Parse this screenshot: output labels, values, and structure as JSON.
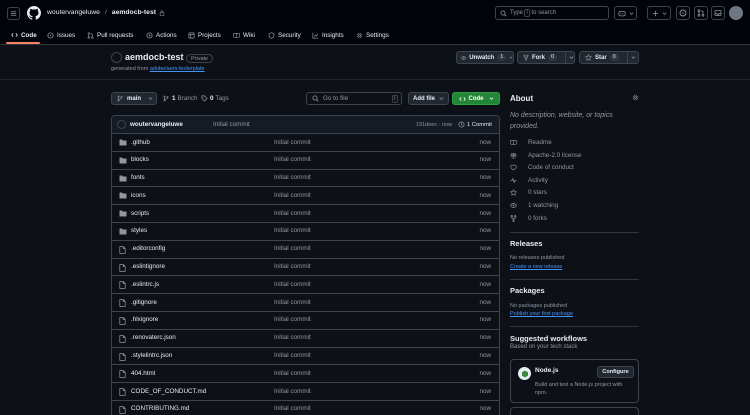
{
  "header": {
    "owner": "woutervangeluwe",
    "slash": "/",
    "repo": "aemdocb-test",
    "search_prefix": "Type",
    "search_key": "/",
    "search_suffix": "to search"
  },
  "tabs": [
    {
      "label": "Code"
    },
    {
      "label": "Issues"
    },
    {
      "label": "Pull requests"
    },
    {
      "label": "Actions"
    },
    {
      "label": "Projects"
    },
    {
      "label": "Wiki"
    },
    {
      "label": "Security"
    },
    {
      "label": "Insights"
    },
    {
      "label": "Settings"
    }
  ],
  "repo": {
    "title": "aemdocb-test",
    "visibility": "Private",
    "generated_from": "generated from",
    "template": "adobe/aem-boilerplate",
    "unwatch_label": "Unwatch",
    "unwatch_count": "1",
    "fork_label": "Fork",
    "fork_count": "0",
    "star_label": "Star",
    "star_count": "0"
  },
  "toolbar": {
    "branch": "main",
    "branch_count": "1",
    "branch_label": "Branch",
    "tag_count": "0",
    "tag_label": "Tags",
    "goto_placeholder": "Go to file",
    "goto_key": "t",
    "add_file": "Add file",
    "code": "Code"
  },
  "latest_commit": {
    "author": "woutervangeluwe",
    "message": "Initial commit",
    "hash_time": "191deec · now",
    "count_label": "1 Commit"
  },
  "files": [
    {
      "name": ".github",
      "type": "dir",
      "message": "Initial commit",
      "time": "now"
    },
    {
      "name": "blocks",
      "type": "dir",
      "message": "Initial commit",
      "time": "now"
    },
    {
      "name": "fonts",
      "type": "dir",
      "message": "Initial commit",
      "time": "now"
    },
    {
      "name": "icons",
      "type": "dir",
      "message": "Initial commit",
      "time": "now"
    },
    {
      "name": "scripts",
      "type": "dir",
      "message": "Initial commit",
      "time": "now"
    },
    {
      "name": "styles",
      "type": "dir",
      "message": "Initial commit",
      "time": "now"
    },
    {
      "name": ".editorconfig",
      "type": "file",
      "message": "Initial commit",
      "time": "now"
    },
    {
      "name": ".eslintignore",
      "type": "file",
      "message": "Initial commit",
      "time": "now"
    },
    {
      "name": ".eslintrc.js",
      "type": "file",
      "message": "Initial commit",
      "time": "now"
    },
    {
      "name": ".gitignore",
      "type": "file",
      "message": "Initial commit",
      "time": "now"
    },
    {
      "name": ".hlxignore",
      "type": "file",
      "message": "Initial commit",
      "time": "now"
    },
    {
      "name": ".renovaterc.json",
      "type": "file",
      "message": "Initial commit",
      "time": "now"
    },
    {
      "name": ".stylelintrc.json",
      "type": "file",
      "message": "Initial commit",
      "time": "now"
    },
    {
      "name": "404.html",
      "type": "file",
      "message": "Initial commit",
      "time": "now"
    },
    {
      "name": "CODE_OF_CONDUCT.md",
      "type": "file",
      "message": "Initial commit",
      "time": "now"
    },
    {
      "name": "CONTRIBUTING.md",
      "type": "file",
      "message": "Initial commit",
      "time": "now"
    }
  ],
  "about": {
    "heading": "About",
    "description": "No description, website, or topics provided.",
    "items": [
      {
        "label": "Readme",
        "icon": "book-icon"
      },
      {
        "label": "Apache-2.0 license",
        "icon": "law-icon"
      },
      {
        "label": "Code of conduct",
        "icon": "heart-icon"
      },
      {
        "label": "Activity",
        "icon": "pulse-icon"
      },
      {
        "label": "0 stars",
        "icon": "star-icon"
      },
      {
        "label": "1 watching",
        "icon": "eye-icon"
      },
      {
        "label": "0 forks",
        "icon": "fork-icon"
      }
    ]
  },
  "releases": {
    "heading": "Releases",
    "empty": "No releases published",
    "link": "Create a new release"
  },
  "packages": {
    "heading": "Packages",
    "empty": "No packages published",
    "link": "Publish your first package"
  },
  "workflows": {
    "heading": "Suggested workflows",
    "subheading": "Based on your tech stack",
    "card_title": "Node.js",
    "card_button": "Configure",
    "card_desc": "Build and test a Node.js project with npm."
  },
  "colors": {
    "bg": "#0d1117",
    "header_bg": "#010409",
    "border": "#3d444d",
    "accent_tab": "#f78166",
    "code_button": "#238636",
    "link": "#4493f8",
    "muted": "#9198a1"
  }
}
